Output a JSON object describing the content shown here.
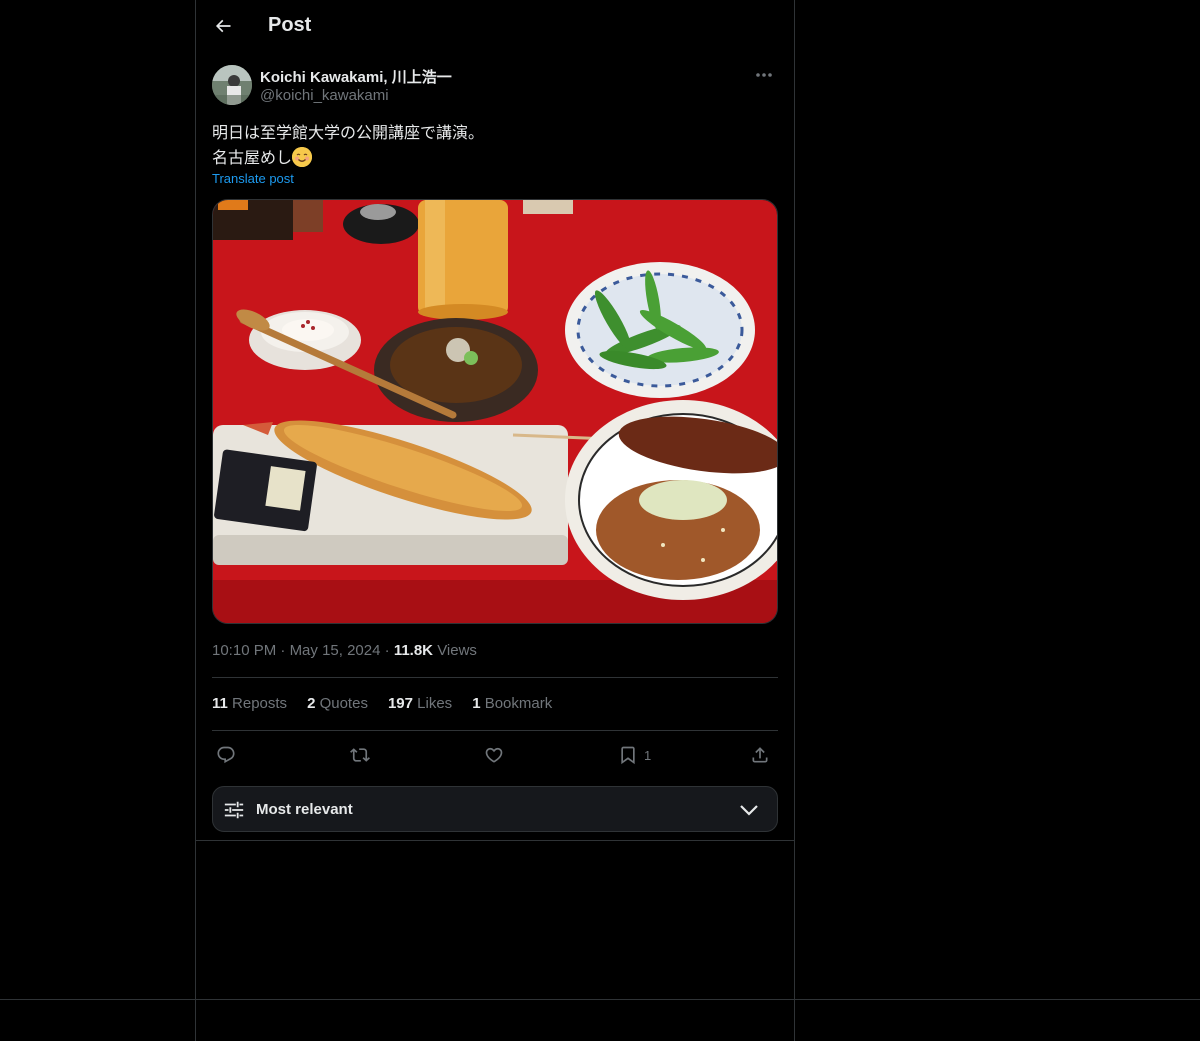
{
  "header": {
    "title": "Post"
  },
  "author": {
    "name": "Koichi Kawakami, 川上浩一",
    "handle": "@koichi_kawakami"
  },
  "post": {
    "line1": "明日は至学館大学の公開講座で講演。",
    "line2": "名古屋めし",
    "emoji": "smiling-face-emoji",
    "translate_label": "Translate post"
  },
  "meta": {
    "time": "10:10 PM",
    "separator": "·",
    "date": "May 15, 2024",
    "views_count": "11.8K",
    "views_label": "Views"
  },
  "stats": {
    "reposts_count": "11",
    "reposts_label": "Reposts",
    "quotes_count": "2",
    "quotes_label": "Quotes",
    "likes_count": "197",
    "likes_label": "Likes",
    "bookmarks_count": "1",
    "bookmarks_label": "Bookmark"
  },
  "actions": {
    "bookmark_count": "1"
  },
  "sort": {
    "label": "Most relevant"
  },
  "colors": {
    "background": "#000000",
    "border": "#2f3336",
    "text_primary": "#e7e9ea",
    "text_secondary": "#71767b",
    "link": "#1d9bf0"
  }
}
